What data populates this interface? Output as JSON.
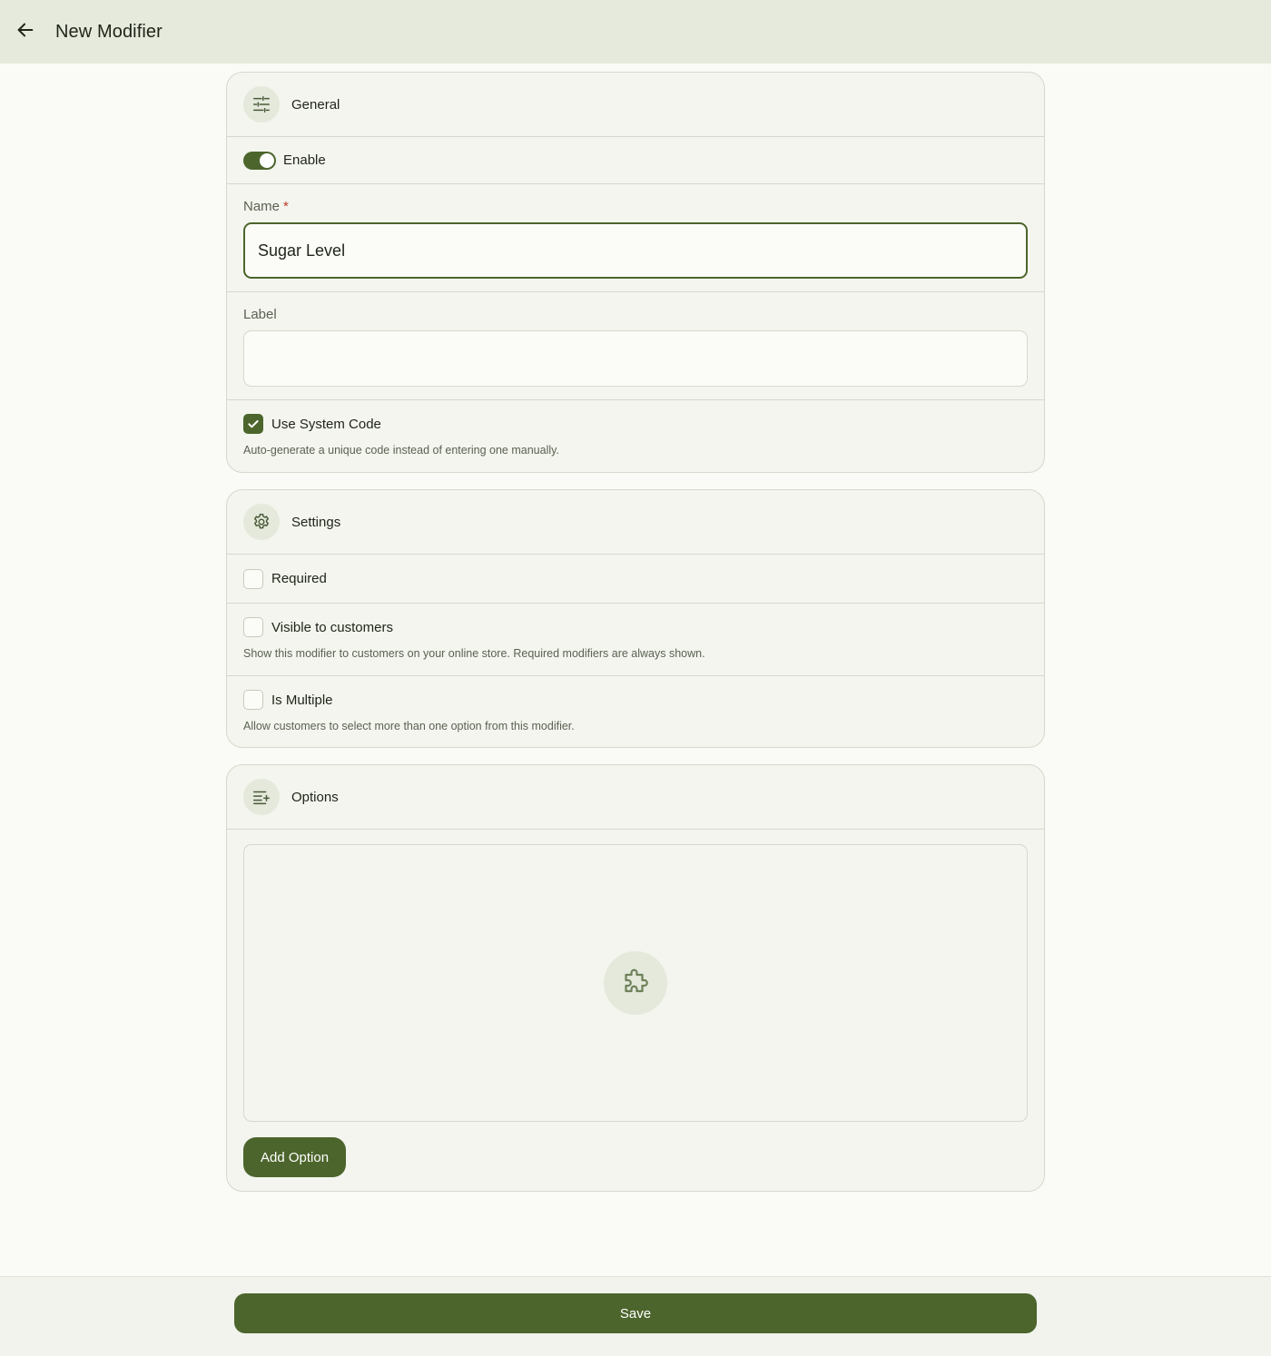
{
  "header": {
    "title": "New Modifier",
    "back_icon": "arrow-left-icon"
  },
  "general": {
    "title": "General",
    "icon": "sliders-icon",
    "enable_label": "Enable",
    "enabled": true,
    "name_label": "Name",
    "name_required_mark": "*",
    "name_value": "Sugar Level",
    "label_label": "Label",
    "label_value": "",
    "use_system_code_label": "Use System Code",
    "use_system_code_checked": true,
    "use_system_code_hint": "Auto-generate a unique code instead of entering one manually."
  },
  "settings": {
    "title": "Settings",
    "icon": "gear-icon",
    "required_label": "Required",
    "required_checked": false,
    "visible_label": "Visible to customers",
    "visible_checked": false,
    "visible_hint": "Show this modifier to customers on your online store. Required modifiers are always shown.",
    "multiple_label": "Is Multiple",
    "multiple_checked": false,
    "multiple_hint": "Allow customers to select more than one option from this modifier."
  },
  "options": {
    "title": "Options",
    "icon": "list-add-icon",
    "empty_icon": "puzzle-icon",
    "add_button_label": "Add Option"
  },
  "footer": {
    "save_label": "Save"
  },
  "colors": {
    "accent": "#4c652c",
    "topbar": "#e5eadd",
    "card": "#f3f5ee",
    "required_mark": "#c0392b"
  }
}
